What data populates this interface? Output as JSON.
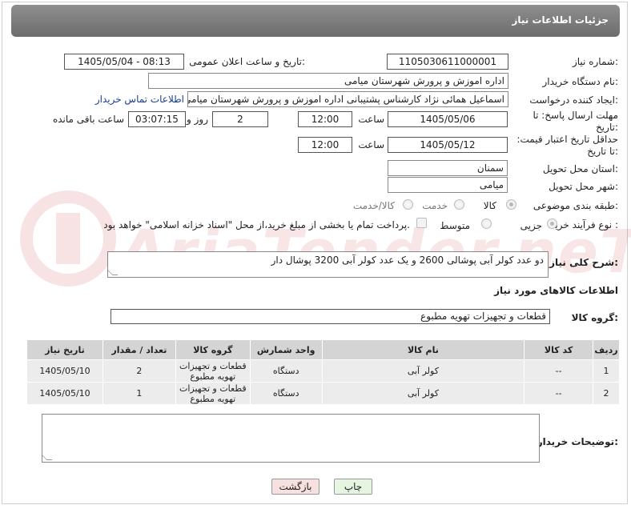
{
  "header": {
    "title": "جزئیات اطلاعات نیاز"
  },
  "fields": {
    "need_number": {
      "label": "شماره نیاز:",
      "value": "1105030611000001"
    },
    "announce": {
      "label": "تاریخ و ساعت اعلان عمومی:",
      "value": "1405/05/04 - 08:13"
    },
    "buyer_org": {
      "label": "نام دستگاه خریدار:",
      "value": "اداره اموزش و پرورش شهرستان میامی"
    },
    "requester": {
      "label": "ایجاد کننده درخواست:",
      "value": "اسماعیل همائی نژاد کارشناس پشتیبانی اداره اموزش و پرورش شهرستان میامی",
      "contact_link": "اطلاعات تماس خریدار"
    },
    "deadline": {
      "label": "مهلت ارسال پاسخ: تا تاریخ:",
      "date": "1405/05/06",
      "time_label": "ساعت",
      "time": "12:00",
      "days": "2",
      "days_label": "روز و",
      "remaining": "03:07:15",
      "remaining_label": "ساعت باقی مانده"
    },
    "validity": {
      "label": "حداقل تاریخ اعتبار قیمت: تا تاریخ:",
      "date": "1405/05/12",
      "time_label": "ساعت",
      "time": "12:00"
    },
    "province": {
      "label": "استان محل تحویل:",
      "value": "سمنان"
    },
    "city": {
      "label": "شهر محل تحویل:",
      "value": "میامی"
    },
    "category": {
      "label": "طبقه بندی موضوعی:",
      "options": [
        "کالا",
        "خدمت",
        "کالا/خدمت"
      ],
      "selected": "کالا"
    },
    "process": {
      "label": "نوع فرآیند خرید :",
      "options": [
        "جزیی",
        "متوسط"
      ],
      "selected": "جزیی",
      "payment_note": "پرداخت تمام یا بخشی از مبلغ خرید،از محل \"اسناد خزانه اسلامی\" خواهد بود."
    }
  },
  "description": {
    "label": "شرح کلی نیاز:",
    "value": "دو عدد کولر آبی پوشالی 2600 و یک عدد کولر آبی 3200 پوشال دار"
  },
  "goods_info": {
    "title": "اطلاعات کالاهای مورد نیاز",
    "group_label": "گروه کالا:",
    "group_value": "قطعات و تجهیزات تهویه مطبوع"
  },
  "table": {
    "headers": [
      "ردیف",
      "کد کالا",
      "نام کالا",
      "واحد شمارش",
      "گروه کالا",
      "تعداد / مقدار",
      "تاریخ نیاز"
    ],
    "rows": [
      [
        "1",
        "--",
        "کولر آبی",
        "دستگاه",
        "قطعات و تجهیزات تهویه مطبوع",
        "2",
        "1405/05/10"
      ],
      [
        "2",
        "--",
        "کولر آبی",
        "دستگاه",
        "قطعات و تجهیزات تهویه مطبوع",
        "1",
        "1405/05/10"
      ]
    ]
  },
  "buyer_notes": {
    "label": "توضیحات خریدار:",
    "value": ""
  },
  "buttons": {
    "print": "چاپ",
    "back": "بازگشت"
  },
  "watermark": {
    "text": "AriaTender.neT"
  },
  "colors": {
    "header_bg": "#7d7d7d",
    "link": "#1a3f8a",
    "print_btn": "#e6f5e0",
    "back_btn": "#f7e0e0",
    "watermark": "#c51f1f"
  }
}
